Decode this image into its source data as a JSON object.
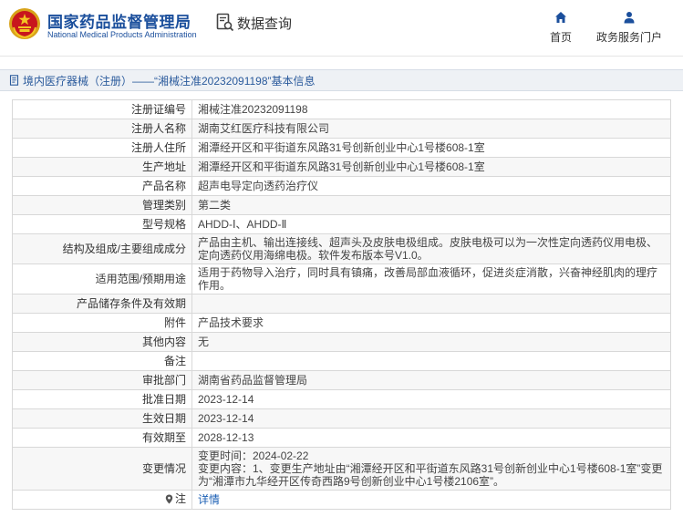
{
  "header": {
    "site_title_cn": "国家药品监督管理局",
    "site_title_en": "National Medical Products Administration",
    "search_nav_label": "数据查询",
    "nav_home_label": "首页",
    "nav_portal_label": "政务服务门户"
  },
  "page_title": "境内医疗器械（注册）——“湘械注准20232091198”基本信息",
  "table": {
    "registration_no": {
      "label": "注册证编号",
      "value": "湘械注准20232091198"
    },
    "registrant_name": {
      "label": "注册人名称",
      "value": "湖南艾红医疗科技有限公司"
    },
    "registrant_address": {
      "label": "注册人住所",
      "value": "湘潭经开区和平街道东风路31号创新创业中心1号楼608-1室"
    },
    "production_address": {
      "label": "生产地址",
      "value": "湘潭经开区和平街道东风路31号创新创业中心1号楼608-1室"
    },
    "product_name": {
      "label": "产品名称",
      "value": "超声电导定向透药治疗仪"
    },
    "management_class": {
      "label": "管理类别",
      "value": "第二类"
    },
    "model_spec": {
      "label": "型号规格",
      "value": "AHDD-Ⅰ、AHDD-Ⅱ"
    },
    "structure": {
      "label": "结构及组成/主要组成成分",
      "value": "产品由主机、输出连接线、超声头及皮肤电极组成。皮肤电极可以为一次性定向透药仪用电极、定向透药仪用海绵电极。软件发布版本号V1.0。"
    },
    "scope": {
      "label": "适用范围/预期用途",
      "value": "适用于药物导入治疗，同时具有镇痛，改善局部血液循环，促进炎症消散，兴奋神经肌肉的理疗作用。"
    },
    "storage": {
      "label": "产品储存条件及有效期",
      "value": ""
    },
    "attachment": {
      "label": "附件",
      "value": "产品技术要求"
    },
    "other": {
      "label": "其他内容",
      "value": "无"
    },
    "remarks": {
      "label": "备注",
      "value": ""
    },
    "approval_dept": {
      "label": "审批部门",
      "value": "湖南省药品监督管理局"
    },
    "approval_date": {
      "label": "批准日期",
      "value": "2023-12-14"
    },
    "effective_date": {
      "label": "生效日期",
      "value": "2023-12-14"
    },
    "expiry_date": {
      "label": "有效期至",
      "value": "2028-12-13"
    },
    "change": {
      "label": "变更情况",
      "time_line": "变更时间：2024-02-22",
      "content_line": "变更内容：1、变更生产地址由“湘潭经开区和平街道东风路31号创新创业中心1号楼608-1室”变更为“湘潭市九华经开区传奇西路9号创新创业中心1号楼2106室”。"
    },
    "note": {
      "label": "注",
      "link_text": "详情"
    }
  },
  "colors": {
    "brand_blue": "#1b4f9c",
    "link_blue": "#1b5fb4",
    "title_bar_bg": "#eef1f5"
  }
}
